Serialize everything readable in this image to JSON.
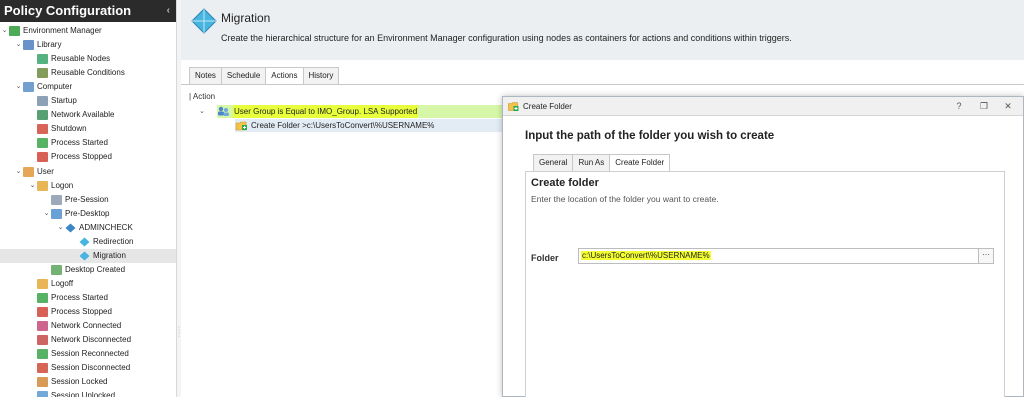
{
  "sidebar": {
    "title": "Policy Configuration",
    "collapse_glyph": "‹",
    "items": [
      {
        "label": "Environment Manager",
        "level": 0,
        "expanded": true,
        "icon": "environment-manager-icon",
        "color": "#2e9b3a"
      },
      {
        "label": "Library",
        "level": 1,
        "expanded": true,
        "icon": "folder-icon",
        "color": "#4f7fbf"
      },
      {
        "label": "Reusable Nodes",
        "level": 2,
        "icon": "reusable-nodes-icon",
        "color": "#3aa56b"
      },
      {
        "label": "Reusable Conditions",
        "level": 2,
        "icon": "reusable-conditions-icon",
        "color": "#6e8b3d"
      },
      {
        "label": "Computer",
        "level": 1,
        "expanded": true,
        "icon": "computer-icon",
        "color": "#5b8fc7"
      },
      {
        "label": "Startup",
        "level": 2,
        "icon": "startup-icon",
        "color": "#7a8fa8"
      },
      {
        "label": "Network Available",
        "level": 2,
        "icon": "network-available-icon",
        "color": "#3a8f5a"
      },
      {
        "label": "Shutdown",
        "level": 2,
        "icon": "shutdown-icon",
        "color": "#d04a3a"
      },
      {
        "label": "Process Started",
        "level": 2,
        "icon": "process-started-icon",
        "color": "#3aa54a"
      },
      {
        "label": "Process Stopped",
        "level": 2,
        "icon": "process-stopped-icon",
        "color": "#d0453a"
      },
      {
        "label": "User",
        "level": 1,
        "expanded": true,
        "icon": "user-icon",
        "color": "#e0973a"
      },
      {
        "label": "Logon",
        "level": 2,
        "expanded": true,
        "icon": "logon-icon",
        "color": "#e4a93a"
      },
      {
        "label": "Pre-Session",
        "level": 3,
        "icon": "pre-session-icon",
        "color": "#8a9aae"
      },
      {
        "label": "Pre-Desktop",
        "level": 3,
        "expanded": true,
        "icon": "pre-desktop-icon",
        "color": "#4f8fcf"
      },
      {
        "label": "ADMINCHECK",
        "level": 4,
        "expanded": true,
        "icon": "node-icon",
        "color": "#3a87c9"
      },
      {
        "label": "Redirection",
        "level": 5,
        "icon": "node-diamond-icon",
        "color": "#48b4e0"
      },
      {
        "label": "Migration",
        "level": 5,
        "selected": true,
        "icon": "node-diamond-icon",
        "color": "#48b4e0"
      },
      {
        "label": "Desktop Created",
        "level": 3,
        "icon": "desktop-created-icon",
        "color": "#5aa55a"
      },
      {
        "label": "Logoff",
        "level": 2,
        "icon": "logoff-icon",
        "color": "#e4a93a"
      },
      {
        "label": "Process Started",
        "level": 2,
        "icon": "process-started-icon",
        "color": "#3aa54a"
      },
      {
        "label": "Process Stopped",
        "level": 2,
        "icon": "process-stopped-icon",
        "color": "#d0453a"
      },
      {
        "label": "Network Connected",
        "level": 2,
        "icon": "network-connected-icon",
        "color": "#c44a7a"
      },
      {
        "label": "Network Disconnected",
        "level": 2,
        "icon": "network-disconnected-icon",
        "color": "#c44a4a"
      },
      {
        "label": "Session Reconnected",
        "level": 2,
        "icon": "session-reconnected-icon",
        "color": "#3aa54a"
      },
      {
        "label": "Session Disconnected",
        "level": 2,
        "icon": "session-disconnected-icon",
        "color": "#d04a3a"
      },
      {
        "label": "Session Locked",
        "level": 2,
        "icon": "session-locked-icon",
        "color": "#d08a3a"
      },
      {
        "label": "Session Unlocked",
        "level": 2,
        "icon": "session-unlocked-icon",
        "color": "#5a9ad0"
      }
    ]
  },
  "header": {
    "title": "Migration",
    "description": "Create the hierarchical structure for an Environment Manager configuration using nodes as containers for actions and conditions within triggers.",
    "icon": "node-diamond-icon"
  },
  "tabs": [
    {
      "label": "Notes",
      "active": false
    },
    {
      "label": "Schedule",
      "active": false
    },
    {
      "label": "Actions",
      "active": true
    },
    {
      "label": "History",
      "active": false
    }
  ],
  "actions": {
    "column_header": "| Action",
    "condition_label": "User Group is Equal to IMO_Group. LSA Supported",
    "action_label": "Create Folder >c:\\UsersToConvert\\%USERNAME%"
  },
  "dialog": {
    "title": "Create Folder",
    "heading": "Input the path of the folder you wish to create",
    "tabs": [
      {
        "label": "General",
        "active": false
      },
      {
        "label": "Run As",
        "active": false
      },
      {
        "label": "Create Folder",
        "active": true
      }
    ],
    "section_title": "Create folder",
    "section_desc": "Enter the location of the folder you want to create.",
    "folder_label": "Folder",
    "folder_value": "c:\\UsersToConvert\\%USERNAME%",
    "browse_label": "···",
    "help_glyph": "?",
    "restore_glyph": "❐",
    "close_glyph": "✕"
  },
  "colors": {
    "highlight": "#e8ff3b",
    "condition_row_bg": "#d6f7a8",
    "selected_row_bg": "#e3ecf5",
    "accent_diamond": "#48b4e0"
  }
}
